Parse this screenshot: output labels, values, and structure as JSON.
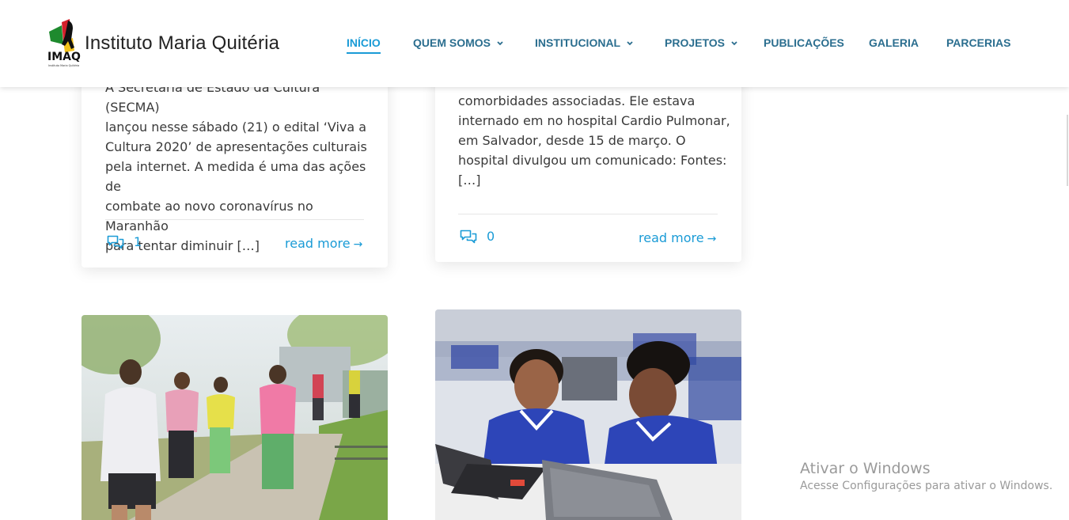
{
  "site": {
    "title": "Instituto Maria Quitéria",
    "logo_text": "IMAQ",
    "logo_subtext": "Instituto Maria Quitéria"
  },
  "nav": {
    "items": [
      {
        "label": "INÍCIO",
        "active": true,
        "dropdown": false
      },
      {
        "label": "QUEM SOMOS",
        "active": false,
        "dropdown": true
      },
      {
        "label": "INSTITUCIONAL",
        "active": false,
        "dropdown": true
      },
      {
        "label": "PROJETOS",
        "active": false,
        "dropdown": true
      },
      {
        "label": "PUBLICAÇÕES",
        "active": false,
        "dropdown": false
      },
      {
        "label": "GALERIA",
        "active": false,
        "dropdown": false
      },
      {
        "label": "PARCERIAS",
        "active": false,
        "dropdown": false
      }
    ]
  },
  "posts": [
    {
      "excerpt_lines": [
        "A Secretaria de Estado da Cultura (SECMA)",
        "lançou nesse sábado (21) o edital ‘Viva a",
        "Cultura 2020’ de apresentações culturais",
        "pela internet. A medida é uma das ações de",
        "combate ao novo coronavírus no Maranhão",
        "para tentar diminuir […]"
      ],
      "comments": "1",
      "read_more": "read more"
    },
    {
      "excerpt_lines": [
        "comorbidades associadas. Ele estava",
        "internado em no hospital Cardio Pulmonar,",
        "em Salvador, desde 15 de março. O",
        "hospital divulgou um comunicado: Fontes:",
        "[…]"
      ],
      "comments": "0",
      "read_more": "read more"
    }
  ],
  "watermark": {
    "title": "Ativar o Windows",
    "subtitle": "Acesse Configurações para ativar o Windows."
  },
  "colors": {
    "accent": "#1a9bd6",
    "nav_text": "#2b6e8f"
  }
}
